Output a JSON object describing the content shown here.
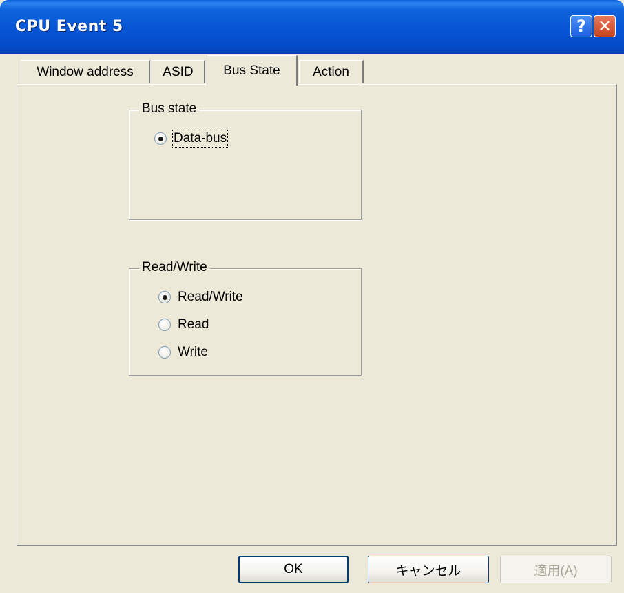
{
  "window": {
    "title": "CPU Event 5",
    "help_icon": "?",
    "close_icon": "✕"
  },
  "tabs": [
    {
      "label": "Window address",
      "active": false
    },
    {
      "label": "ASID",
      "active": false
    },
    {
      "label": "Bus State",
      "active": true
    },
    {
      "label": "Action",
      "active": false
    }
  ],
  "bus_state": {
    "legend": "Bus state",
    "options": [
      {
        "label": "Data-bus",
        "checked": true
      }
    ]
  },
  "read_write": {
    "legend": "Read/Write",
    "options": [
      {
        "label": "Read/Write",
        "checked": true
      },
      {
        "label": "Read",
        "checked": false
      },
      {
        "label": "Write",
        "checked": false
      }
    ]
  },
  "buttons": {
    "ok": "OK",
    "cancel": "キャンセル",
    "apply": "適用(A)"
  },
  "colors": {
    "titlebar": "#0553d2",
    "face": "#ece9d8",
    "close": "#c7411f"
  }
}
